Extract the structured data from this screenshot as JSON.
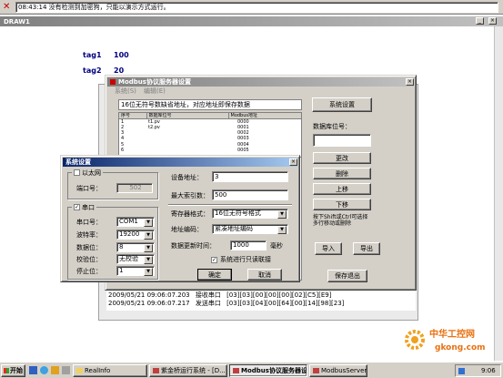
{
  "status_bar": {
    "message": "08:43:14 没有检测到加密狗，只能以演示方式运行。",
    "close_icon": "close-x-icon"
  },
  "main_window": {
    "title": "DRAW1"
  },
  "tags": [
    {
      "label": "tag1",
      "value": "100"
    },
    {
      "label": "tag2",
      "value": "20"
    }
  ],
  "modbus_window": {
    "title": "Modbus协议服务器设置",
    "menu": [
      "系统(S)",
      "编辑(E)"
    ],
    "hint": "16位无符号数缺省地址，对应地址即保存数据",
    "columns": [
      "序号",
      "数据库位号",
      "Modbus地址"
    ],
    "rows": [
      [
        "1",
        "t1.pv",
        "0000"
      ],
      [
        "2",
        "t2.pv",
        "0001"
      ],
      [
        "3",
        "",
        "0002"
      ],
      [
        "4",
        "",
        "0003"
      ],
      [
        "5",
        "",
        "0004"
      ],
      [
        "6",
        "",
        "0005"
      ]
    ],
    "buttons": {
      "system": "系统设置",
      "change": "更改",
      "delete": "删除",
      "up": "上移",
      "down": "下移",
      "import": "导入",
      "export": "导出",
      "save_exit": "保存退出"
    },
    "db_label": "数据库位号：",
    "db_value": "",
    "tip": "按下Shift或Ctrl可选择多行移动或删除"
  },
  "log": [
    {
      "time": "2009/05/21 09:06:07.203",
      "type": "接收串口",
      "data": "[03][03][00][00][00][02][C5][E9]"
    },
    {
      "time": "2009/05/21 09:06:07.217",
      "type": "发送串口",
      "data": "[03][03][04][00][64][00][14][98][23]"
    }
  ],
  "sys_dialog": {
    "title": "系统设置",
    "ethernet": {
      "label": "以太网",
      "checked": false,
      "port_label": "端口号：",
      "port_value": "502"
    },
    "serial": {
      "label": "串口",
      "checked": true,
      "fields": [
        {
          "label": "串口号：",
          "value": "COM1"
        },
        {
          "label": "波特率：",
          "value": "19200"
        },
        {
          "label": "数据位：",
          "value": "8"
        },
        {
          "label": "校验位：",
          "value": "无校验"
        },
        {
          "label": "停止位：",
          "value": "1"
        }
      ]
    },
    "device_addr": {
      "label": "设备地址：",
      "value": "3"
    },
    "max_index": {
      "label": "最大索引数：",
      "value": "500"
    },
    "reg_format": {
      "label": "寄存器格式：",
      "value": "16位无符号格式"
    },
    "addr_encoding": {
      "label": "地址编码：",
      "value": "紧凑地址编码"
    },
    "refresh": {
      "label": "数据更新时间：",
      "value": "1000",
      "unit": "毫秒"
    },
    "readonly": {
      "label": "系统进行只读联接",
      "checked": true
    },
    "ok": "确定",
    "cancel": "取消"
  },
  "taskbar": {
    "start": "开始",
    "items": [
      "RealInfo",
      "紫金桥运行系统 - [D...",
      "Modbus协议服务器设置",
      "ModbusServer"
    ],
    "clock": "9:06"
  },
  "watermark": {
    "brand": "中华工控网",
    "url": "gkong.com"
  }
}
